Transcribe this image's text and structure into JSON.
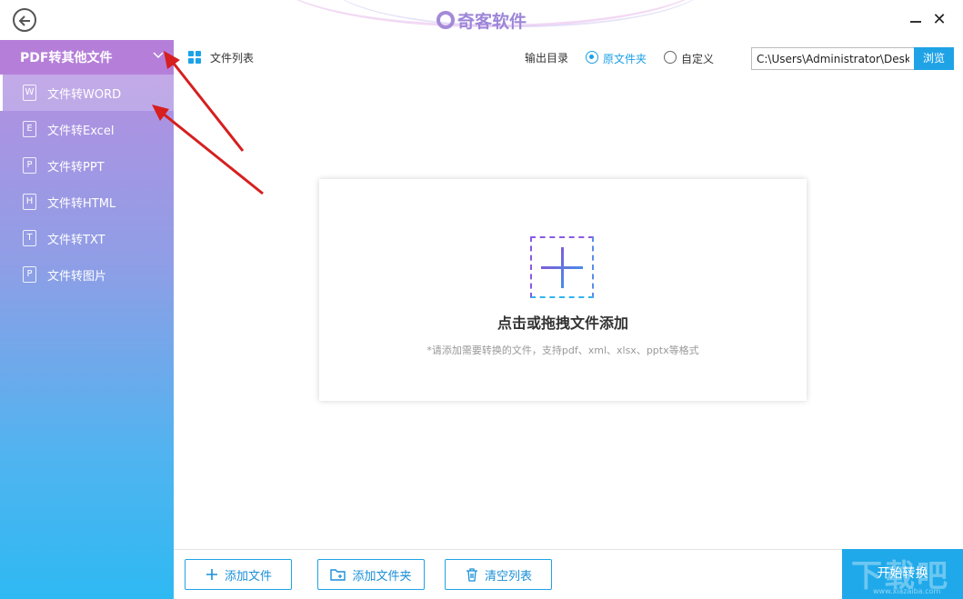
{
  "titlebar": {
    "brand": "奇客软件",
    "back_icon": "back-arrow-icon",
    "minimize_icon": "minimize-icon",
    "close_icon": "close-icon",
    "close_glyph": "✕"
  },
  "sidebar": {
    "header": "PDF转其他文件",
    "items": [
      {
        "label": "文件转WORD",
        "icon_letter": "W",
        "active": true
      },
      {
        "label": "文件转Excel",
        "icon_letter": "E",
        "active": false
      },
      {
        "label": "文件转PPT",
        "icon_letter": "P",
        "active": false
      },
      {
        "label": "文件转HTML",
        "icon_letter": "H",
        "active": false
      },
      {
        "label": "文件转TXT",
        "icon_letter": "T",
        "active": false
      },
      {
        "label": "文件转图片",
        "icon_letter": "P",
        "active": false
      }
    ]
  },
  "toolbar": {
    "file_list_label": "文件列表",
    "output_dir_label": "输出目录",
    "option_source": "原文件夹",
    "option_custom": "自定义",
    "selected_option": "原文件夹",
    "path_value": "C:\\Users\\Administrator\\Desk",
    "browse_label": "浏览"
  },
  "dropzone": {
    "title": "点击或拖拽文件添加",
    "hint": "*请添加需要转换的文件，支持pdf、xml、xlsx、pptx等格式"
  },
  "bottom": {
    "add_file": "添加文件",
    "add_folder": "添加文件夹",
    "clear_list": "清空列表",
    "start": "开始转换"
  },
  "watermark": {
    "text": "下载吧",
    "url": "www.xiazaiba.com"
  },
  "colors": {
    "accent": "#1fa3e6",
    "sidebar_header": "#b57fd9",
    "annotation_arrow": "#d61f1f",
    "brand": "#9d86d8"
  }
}
